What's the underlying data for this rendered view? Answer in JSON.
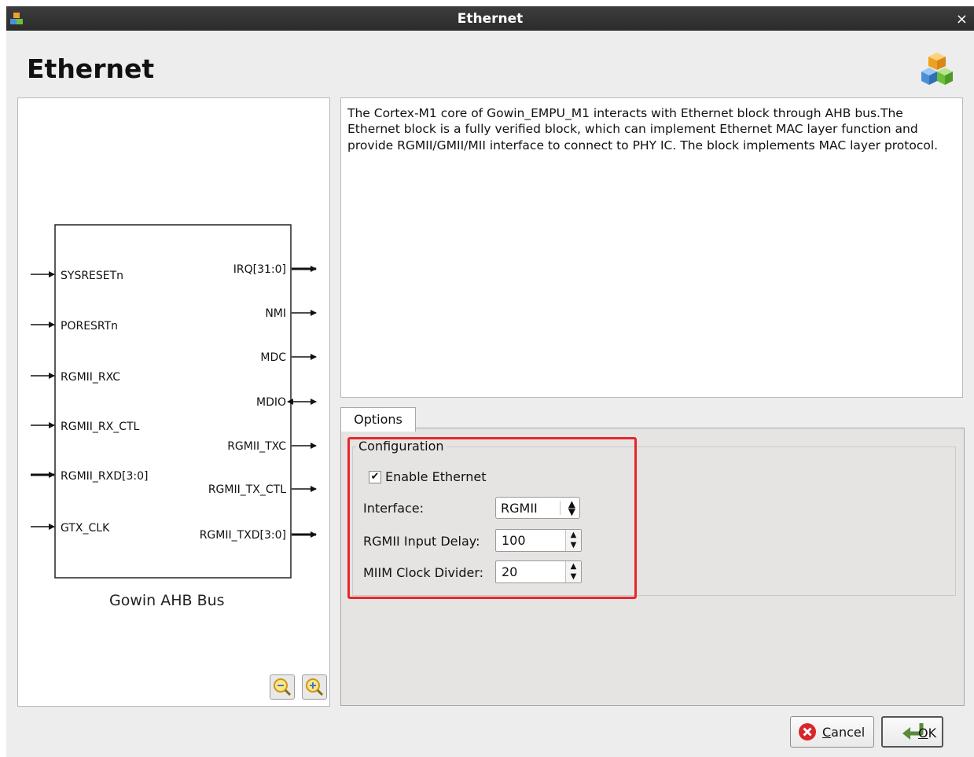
{
  "window": {
    "title": "Ethernet",
    "close_glyph": "×"
  },
  "header": {
    "title": "Ethernet",
    "icon": "colored-cubes-icon"
  },
  "diagram": {
    "block_name": "Gowin AHB Bus",
    "inputs": [
      "SYSRESETn",
      "PORESRTn",
      "RGMII_RXC",
      "RGMII_RX_CTL",
      "RGMII_RXD[3:0]",
      "GTX_CLK"
    ],
    "outputs": [
      "IRQ[31:0]",
      "NMI",
      "MDC",
      "MDIO",
      "RGMII_TXC",
      "RGMII_TX_CTL",
      "RGMII_TXD[3:0]"
    ]
  },
  "description": "The Cortex-M1 core of Gowin_EMPU_M1 interacts with Ethernet block through AHB bus.The Ethernet block is a fully verified block, which can implement Ethernet MAC layer function and provide RGMII/GMII/MII interface to connect to PHY IC. The block implements MAC layer protocol.",
  "tabs": [
    {
      "label": "Options",
      "active": true
    }
  ],
  "config": {
    "group_title": "Configuration",
    "enable_label": "Enable Ethernet",
    "enable_checked": true,
    "interface_label": "Interface:",
    "interface_value": "RGMII",
    "delay_label": "RGMII Input Delay:",
    "delay_value": "100",
    "divider_label": "MIIM Clock Divider:",
    "divider_value": "20"
  },
  "buttons": {
    "cancel": {
      "mnemonic": "C",
      "rest": "ancel"
    },
    "ok": {
      "mnemonic": "O",
      "rest": "K"
    }
  },
  "colors": {
    "titlebar": "#2f2f2f",
    "highlight": "#e8252c",
    "accent": "#3c78c8"
  }
}
